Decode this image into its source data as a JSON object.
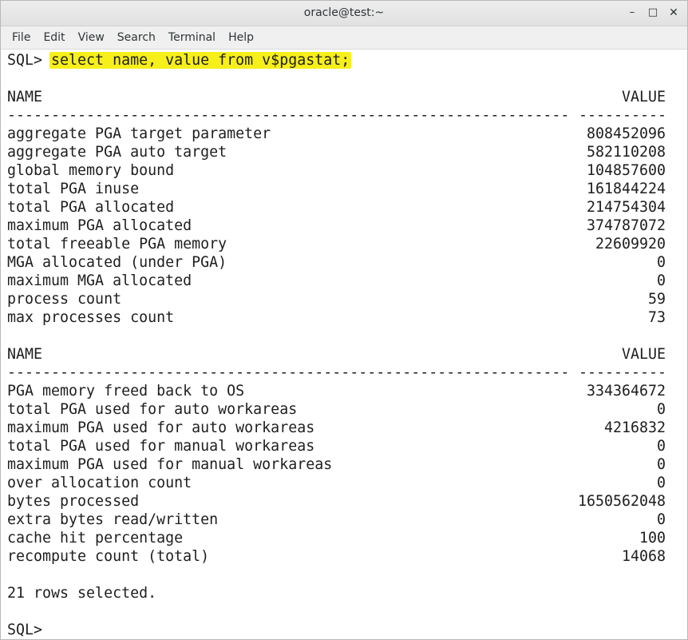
{
  "window": {
    "title": "oracle@test:~",
    "controls": {
      "minimize": "–",
      "maximize": "□",
      "close": "✕"
    }
  },
  "menu": [
    "File",
    "Edit",
    "View",
    "Search",
    "Terminal",
    "Help"
  ],
  "terminal": {
    "prompt": "SQL> ",
    "command": "select name, value from v$pgastat;",
    "header_name": "NAME",
    "header_value": "VALUE",
    "dash_name": "----------------------------------------------------------------",
    "dash_value": "----------",
    "block1": [
      {
        "name": "aggregate PGA target parameter",
        "value": "808452096"
      },
      {
        "name": "aggregate PGA auto target",
        "value": "582110208"
      },
      {
        "name": "global memory bound",
        "value": "104857600"
      },
      {
        "name": "total PGA inuse",
        "value": "161844224"
      },
      {
        "name": "total PGA allocated",
        "value": "214754304"
      },
      {
        "name": "maximum PGA allocated",
        "value": "374787072"
      },
      {
        "name": "total freeable PGA memory",
        "value": "22609920"
      },
      {
        "name": "MGA allocated (under PGA)",
        "value": "0"
      },
      {
        "name": "maximum MGA allocated",
        "value": "0"
      },
      {
        "name": "process count",
        "value": "59"
      },
      {
        "name": "max processes count",
        "value": "73"
      }
    ],
    "block2": [
      {
        "name": "PGA memory freed back to OS",
        "value": "334364672"
      },
      {
        "name": "total PGA used for auto workareas",
        "value": "0"
      },
      {
        "name": "maximum PGA used for auto workareas",
        "value": "4216832"
      },
      {
        "name": "total PGA used for manual workareas",
        "value": "0"
      },
      {
        "name": "maximum PGA used for manual workareas",
        "value": "0"
      },
      {
        "name": "over allocation count",
        "value": "0"
      },
      {
        "name": "bytes processed",
        "value": "1650562048"
      },
      {
        "name": "extra bytes read/written",
        "value": "0"
      },
      {
        "name": "cache hit percentage",
        "value": "100"
      },
      {
        "name": "recompute count (total)",
        "value": "14068"
      }
    ],
    "rows_selected": "21 rows selected.",
    "final_prompt": "SQL> "
  }
}
